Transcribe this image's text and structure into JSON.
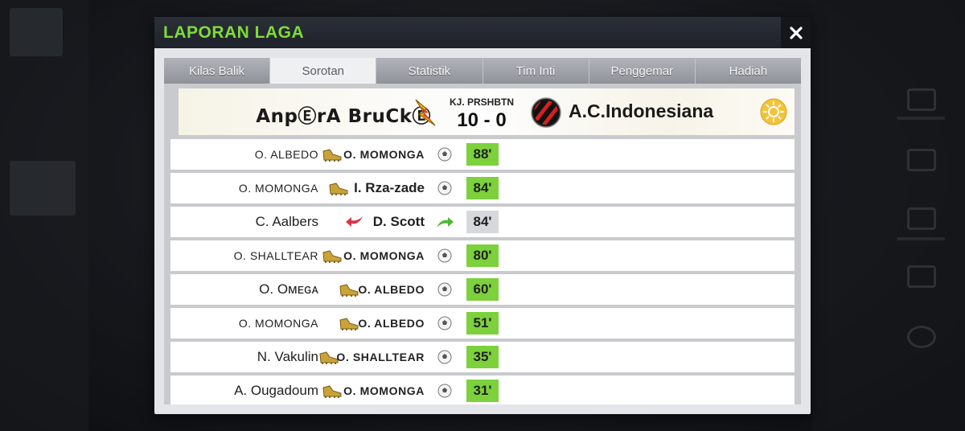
{
  "dialog": {
    "title": "LAPORAN LAGA",
    "close_icon": "close-icon"
  },
  "tabs": [
    {
      "label": "Kilas Balik",
      "active": false
    },
    {
      "label": "Sorotan",
      "active": true
    },
    {
      "label": "Statistik",
      "active": false
    },
    {
      "label": "Tim Inti",
      "active": false
    },
    {
      "label": "Penggemar",
      "active": false
    },
    {
      "label": "Hadiah",
      "active": false
    }
  ],
  "match": {
    "home_team": "AnpⒺrA BruCkⒺ",
    "competition": "KJ. PRSHBTN",
    "score": "10 - 0",
    "away_team": "A.C.Indonesiana",
    "weather": "sun-icon"
  },
  "events": [
    {
      "type": "goal",
      "assist": "O. ALBEDO",
      "scorer": "O. MOMONGA",
      "minute": "88'"
    },
    {
      "type": "goal",
      "assist": "O. MOMONGA",
      "scorer": "I. Rza-zade",
      "minute": "84'"
    },
    {
      "type": "substitution",
      "assist": "C. Aalbers",
      "scorer": "D. Scott",
      "minute": "84'"
    },
    {
      "type": "goal",
      "assist": "O. SHALLTEAR",
      "scorer": "O. MOMONGA",
      "minute": "80'"
    },
    {
      "type": "goal",
      "assist": "O. Oᴍᴇɢᴀ",
      "scorer": "O. ALBEDO",
      "minute": "60'"
    },
    {
      "type": "goal",
      "assist": "O. MOMONGA",
      "scorer": "O. ALBEDO",
      "minute": "51'"
    },
    {
      "type": "goal",
      "assist": "N. Vakulin",
      "scorer": "O. SHALLTEAR",
      "minute": "35'"
    },
    {
      "type": "goal",
      "assist": "A. Ougadoum",
      "scorer": "O. MOMONGA",
      "minute": "31'"
    }
  ],
  "colors": {
    "title": "#7ddc3a",
    "minute_goal": "#7cd13c",
    "minute_sub": "#d6d8db",
    "sub_out_arrow": "#d9344a",
    "sub_in_arrow": "#4fb83a"
  }
}
